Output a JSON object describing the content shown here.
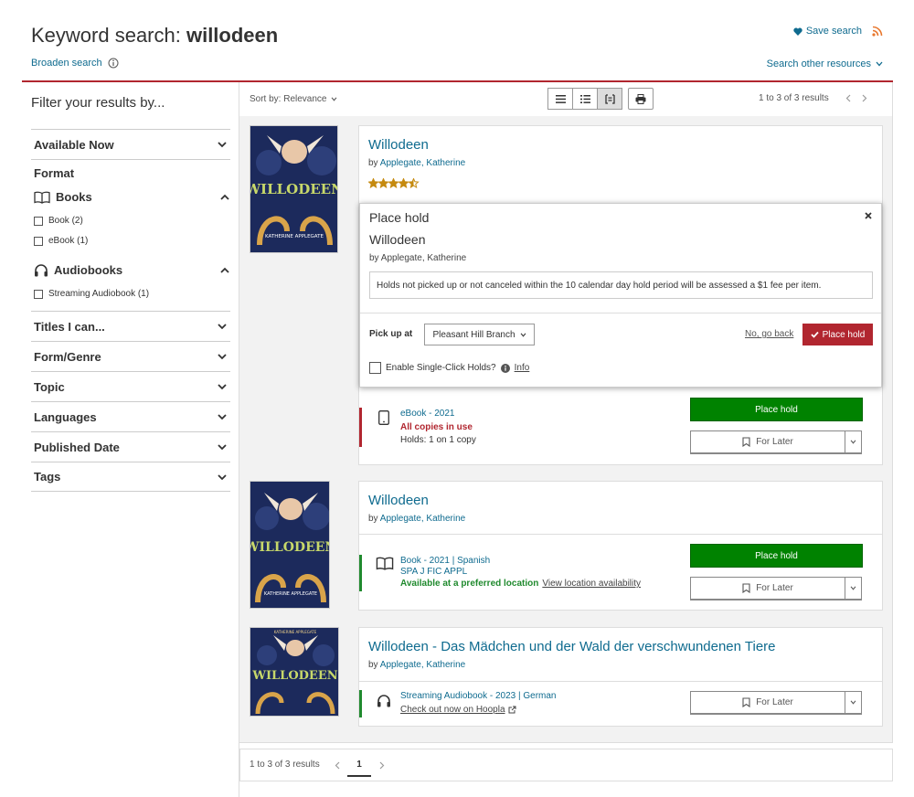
{
  "header": {
    "title_prefix": "Keyword search: ",
    "query": "willodeen",
    "broaden_label": "Broaden search",
    "save_search_label": "Save search",
    "search_other_label": "Search other resources"
  },
  "sidebar": {
    "title": "Filter your results by...",
    "available_now": "Available Now",
    "format_label": "Format",
    "books_label": "Books",
    "book_option": "Book (2)",
    "ebook_option": "eBook (1)",
    "audiobooks_label": "Audiobooks",
    "streaming_option": "Streaming Audiobook (1)",
    "facets": [
      "Titles I can...",
      "Form/Genre",
      "Topic",
      "Languages",
      "Published Date",
      "Tags"
    ]
  },
  "toolbar": {
    "sort_label": "Sort by: Relevance",
    "results_count": "1 to 3 of 3 results"
  },
  "results": [
    {
      "title": "Willodeen",
      "by": "by ",
      "author": "Applegate, Katherine",
      "rating": 4.5,
      "cover_title": "WILLODEEN",
      "cover_author": "KATHERINE APPLEGATE",
      "format": "eBook - 2021",
      "status": "All copies in use",
      "holds": "Holds: 1 on 1 copy",
      "primary_action": "Place hold",
      "secondary_action": "For Later"
    },
    {
      "title": "Willodeen",
      "by": "by ",
      "author": "Applegate, Katherine",
      "cover_title": "WILLODEEN",
      "cover_author": "KATHERINE APPLEGATE",
      "format": "Book - 2021 | Spanish",
      "call_number": "SPA J FIC APPL",
      "status": "Available at a preferred location",
      "location_link": "View location availability",
      "primary_action": "Place hold",
      "secondary_action": "For Later"
    },
    {
      "title": "Willodeen - Das Mädchen und der Wald der verschwundenen Tiere",
      "by": "by ",
      "author": "Applegate, Katherine",
      "cover_title": "WILLODEEN",
      "cover_author": "KATHERINE APPLEGATE",
      "format": "Streaming Audiobook - 2023 | German",
      "checkout_link": "Check out now on Hoopla",
      "secondary_action": "For Later"
    }
  ],
  "hold_popup": {
    "heading": "Place hold",
    "title": "Willodeen",
    "byline": "by Applegate, Katherine",
    "notice": "Holds not picked up or not canceled within the 10 calendar day hold period will be assessed a $1 fee per item.",
    "pickup_label": "Pick up at",
    "pickup_value": "Pleasant Hill Branch",
    "cancel_label": "No, go back",
    "confirm_label": "Place hold",
    "single_click_label": "Enable Single-Click Holds?",
    "info_label": "Info"
  },
  "pager": {
    "summary": "1 to 3 of 3 results",
    "current_page": "1"
  },
  "colors": {
    "brand_red": "#b1262f",
    "link_blue": "#0f6b8f",
    "available_green": "#008200",
    "star_gold": "#c58a0f"
  }
}
